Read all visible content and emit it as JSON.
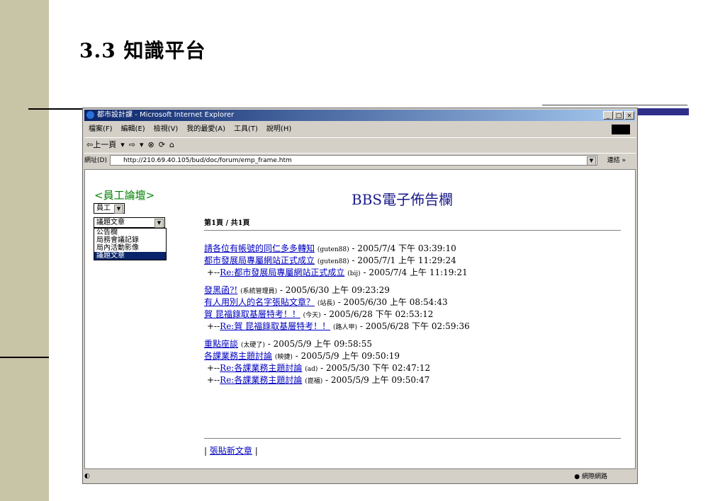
{
  "slide": {
    "title": "3.3 知識平台"
  },
  "window": {
    "title": "都市設計課 - Microsoft Internet Explorer",
    "controls": [
      "_",
      "□",
      "×"
    ],
    "menus": [
      "檔案(F)",
      "編輯(E)",
      "檢視(V)",
      "我的最愛(A)",
      "工具(T)",
      "說明(H)"
    ],
    "toolbar": {
      "back": "⇦上一頁",
      "back_dd": "▾",
      "forward": "⇨",
      "forward_dd": "▾",
      "stop": "⊗",
      "refresh": "⟳",
      "home": "⌂"
    },
    "address_label": "網址(D)",
    "address_url": "http://210.69.40.105/bud/doc/forum/emp_frame.htm",
    "go_label": "連結 »",
    "status_zone": "網際網路"
  },
  "forum": {
    "heading": "<員工論壇>",
    "select1": "員工",
    "select2": "議題文章",
    "dropdown_options": [
      "公告欄",
      "局務會議記錄",
      "局內活動影像",
      "議題文章"
    ],
    "board_title": "BBS電子佈告欄",
    "page_info": "第1頁 / 共1頁",
    "posts": [
      {
        "title": "請各位有帳號的同仁多多轉知",
        "author": "(guten88)",
        "date": " - 2005/7/4 下午 03:39:10"
      },
      {
        "title": "都市發展局專屬網站正式成立",
        "author": "(guten88)",
        "date": " - 2005/7/1 上午 11:29:24"
      },
      {
        "reply": true,
        "prefix": "+--",
        "title": "Re:都市發展局專屬網站正式成立",
        "author": "(bij)",
        "date": " - 2005/7/4 上午 11:19:21"
      },
      {
        "title": "發黑函?!",
        "author": "(系統管理員)",
        "date": " - 2005/6/30 上午 09:23:29"
      },
      {
        "title": "有人用別人的名字張貼文章？",
        "author": "(站長)",
        "date": " - 2005/6/30 上午 08:54:43"
      },
      {
        "title": "賀 昆福錄取基層特考！！",
        "author": "(今天)",
        "date": " - 2005/6/28 下午 02:53:12"
      },
      {
        "reply": true,
        "prefix": "+--",
        "title": "Re:賀 昆福錄取基層特考！！",
        "author": "(路人甲)",
        "date": " - 2005/6/28 下午 02:59:36"
      },
      {
        "title": "重點座談",
        "author": "(太硬了)",
        "date": " - 2005/5/9 上午 09:58:55"
      },
      {
        "title": "各課業務主題討論",
        "author": "(映捷)",
        "date": " - 2005/5/9 上午 09:50:19"
      },
      {
        "reply": true,
        "prefix": "+--",
        "title": "Re:各課業務主題討論",
        "author": "(ad)",
        "date": " - 2005/5/30 下午 02:47:12"
      },
      {
        "reply": true,
        "prefix": "+--",
        "title": "Re:各課業務主題討論",
        "author": "(崑福)",
        "date": " - 2005/5/9 上午 09:50:47"
      }
    ],
    "new_post_prefix": "| ",
    "new_post": "張貼新文章",
    "new_post_suffix": " |"
  }
}
